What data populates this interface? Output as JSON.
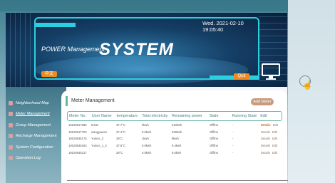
{
  "banner": {
    "datetime": "Wed. 2021-02-10 19:05:40",
    "brand": "POWER Management",
    "brand_sub": "",
    "title": "SYSTEM",
    "lang_button": "中文",
    "quit_button": "Quit"
  },
  "sidebar": {
    "items": [
      {
        "label": "Neighborhood Map"
      },
      {
        "label": "Meter Management"
      },
      {
        "label": "Group Management"
      },
      {
        "label": "Recharge Management"
      },
      {
        "label": "System Configuration"
      },
      {
        "label": "Operation Log"
      }
    ]
  },
  "panel": {
    "title": "Meter Management",
    "add_button": "Add Meter",
    "columns": [
      "Meter No.",
      "User Name",
      "temperature",
      "Total electricity",
      "Remaining power",
      "State",
      "Running State",
      "Edit"
    ],
    "rows": [
      {
        "meter": "19100617695",
        "user": "tester",
        "temp": "37.7°C",
        "total": "0kwh",
        "remaining": "210kwh",
        "state": "Offline",
        "running": "-",
        "details": "Details",
        "edit": "Edit"
      },
      {
        "meter": "19100617703",
        "user": "wangyawen",
        "temp": "37.4°C",
        "total": "0.0kwh",
        "remaining": "330kwh",
        "state": "Offline",
        "running": "-",
        "details": "Details",
        "edit": "Edit"
      },
      {
        "meter": "19100635175",
        "user": "Yuince_2",
        "temp": "39°C",
        "total": "1kwh",
        "remaining": "9kwh",
        "state": "Offline",
        "running": "-",
        "details": "Details",
        "edit": "Edit"
      },
      {
        "meter": "19100645163",
        "user": "Yuince_1_2",
        "temp": "37.6°C",
        "total": "0.0kwh",
        "remaining": "9.4kwh",
        "state": "Offline",
        "running": "-",
        "details": "Details",
        "edit": "Edit"
      },
      {
        "meter": "19100645217",
        "user": "",
        "temp": "28°C",
        "total": "0.5kwh",
        "remaining": "9.5kwh",
        "state": "Offline",
        "running": "-",
        "details": "Details",
        "edit": "Edit"
      }
    ]
  },
  "colors": {
    "accent": "#f08a1e",
    "header_border": "#6fb5a9",
    "banner_line": "#2bd0e0"
  }
}
